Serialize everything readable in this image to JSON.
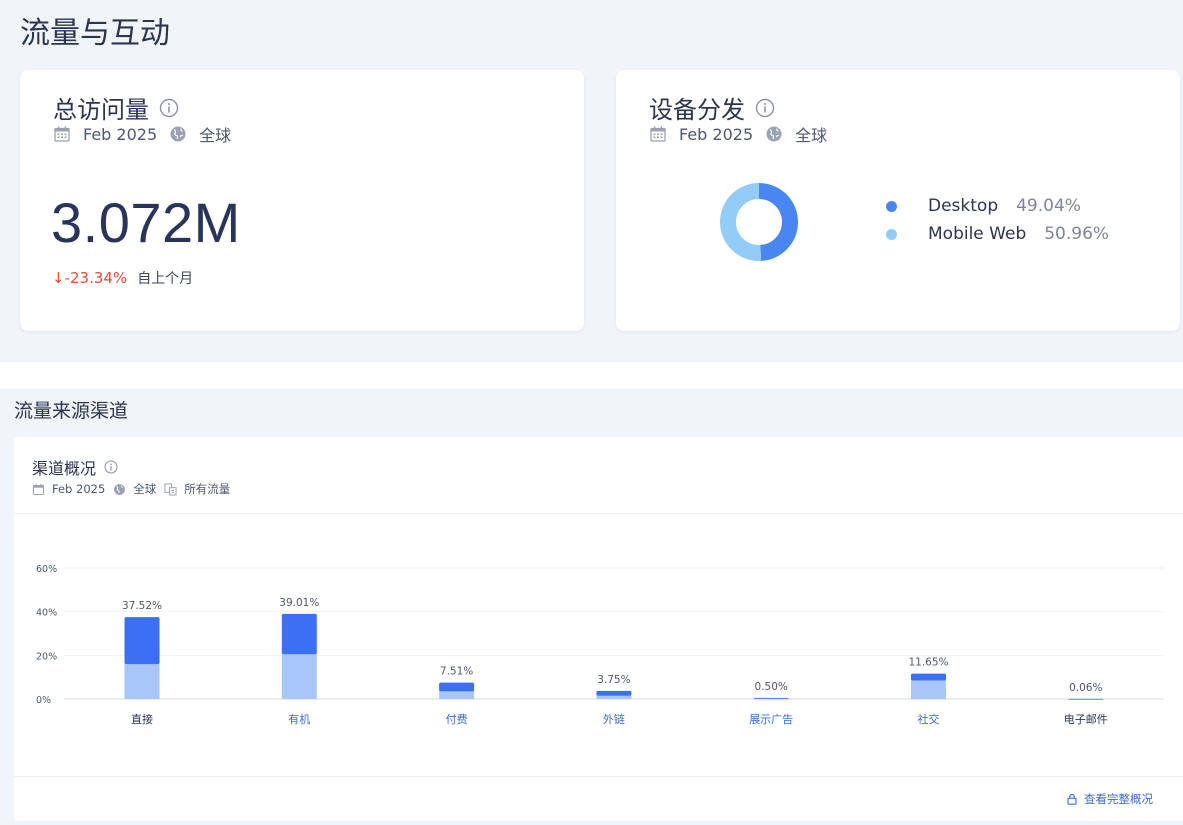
{
  "page": {
    "title": "流量与互动"
  },
  "colors": {
    "accent": "#3d6ff5",
    "light_blue": "#a9c6fb",
    "negative": "#ec4b3c",
    "donut_desktop": "#4a86f3",
    "donut_mobile": "#93cdf7"
  },
  "visits_card": {
    "title": "总访问量",
    "date": "Feb 2025",
    "region": "全球",
    "total": "3.072M",
    "change": "↓-23.34%",
    "change_suffix": "自上个月"
  },
  "device_card": {
    "title": "设备分发",
    "date": "Feb 2025",
    "region": "全球",
    "items": [
      {
        "label": "Desktop",
        "value": "49.04%",
        "share": 49.04,
        "color": "#4a86f3"
      },
      {
        "label": "Mobile Web",
        "value": "50.96%",
        "share": 50.96,
        "color": "#93cdf7"
      }
    ]
  },
  "channels_section": {
    "title": "流量来源渠道",
    "card_title": "渠道概况",
    "date": "Feb 2025",
    "region": "全球",
    "traffic_type": "所有流量",
    "full_link": "查看完整概况"
  },
  "chart_data": {
    "type": "bar",
    "stacked": true,
    "ylim": [
      0,
      60
    ],
    "yticks": [
      "0%",
      "20%",
      "40%",
      "60%"
    ],
    "ytick_values": [
      0,
      20,
      40,
      60
    ],
    "categories": [
      "直接",
      "有机",
      "付费",
      "外链",
      "展示广告",
      "社交",
      "电子邮件"
    ],
    "category_colors": [
      "#2b3550",
      "#3b6bd8",
      "#3b6bd8",
      "#3b6bd8",
      "#3b6bd8",
      "#3b6bd8",
      "#2b3550"
    ],
    "totals": [
      37.52,
      39.01,
      7.51,
      3.75,
      0.5,
      11.65,
      0.06
    ],
    "value_labels": [
      "37.52%",
      "39.01%",
      "7.51%",
      "3.75%",
      "0.50%",
      "11.65%",
      "0.06%"
    ],
    "series": [
      {
        "values": [
          16.0,
          20.5,
          3.5,
          1.5,
          0.3,
          8.5,
          0.04
        ],
        "color": "#a9c6fb"
      },
      {
        "values": [
          21.52,
          18.51,
          4.01,
          2.25,
          0.2,
          3.15,
          0.02
        ],
        "color": "#3d6ff5"
      }
    ],
    "grid": true
  }
}
